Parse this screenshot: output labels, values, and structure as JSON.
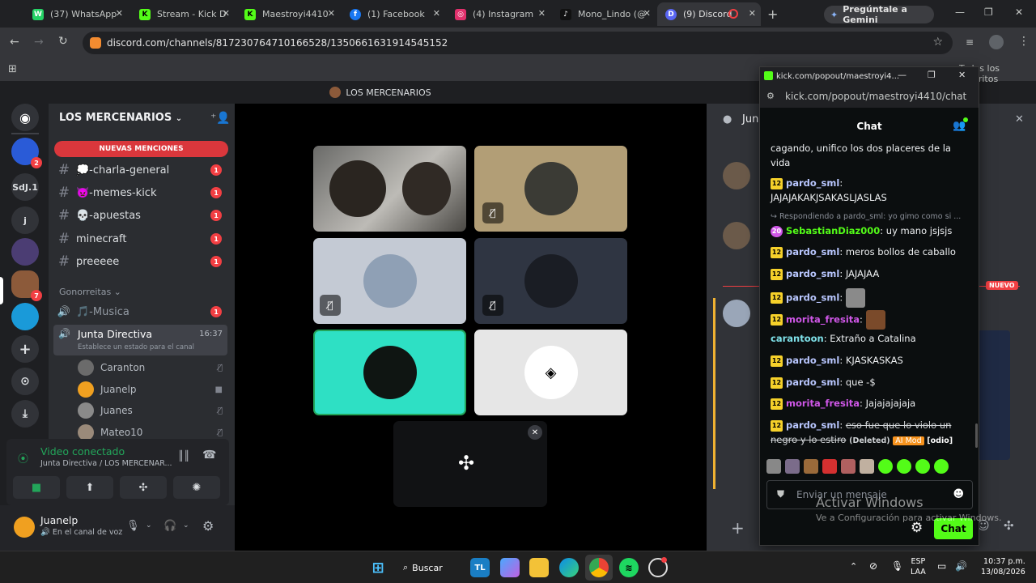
{
  "browser": {
    "tabs": [
      {
        "label": "(37) WhatsApp",
        "color": "#25d366",
        "glyph": "W"
      },
      {
        "label": "Stream - Kick D",
        "color": "#53fc18",
        "glyph": "K"
      },
      {
        "label": "Maestroyi4410",
        "color": "#53fc18",
        "glyph": "K"
      },
      {
        "label": "(1) Facebook",
        "color": "#1877f2",
        "glyph": "f"
      },
      {
        "label": "(4) Instagram",
        "color": "#e1306c",
        "glyph": "◎"
      },
      {
        "label": "Mono_Lindo (@",
        "color": "#111111",
        "glyph": "♪"
      },
      {
        "label": "(9) Discord",
        "color": "#5865f2",
        "glyph": "D"
      }
    ],
    "new_tab_icon": "+",
    "gemini_label": "Pregúntale a Gemini",
    "url": "discord.com/channels/817230764710166528/1350661631914545152",
    "bookmarks_label": "Todos los favoritos"
  },
  "discord": {
    "window_title": "LOS MERCENARIOS",
    "server_name": "LOS MERCENARIOS",
    "servers": [
      {
        "label": "",
        "badge": "2",
        "color": "#2a5bd7"
      },
      {
        "label": "SdJ.1",
        "badge": "",
        "color": "#313338"
      },
      {
        "label": "j",
        "badge": "",
        "color": "#313338"
      },
      {
        "label": "",
        "badge": "",
        "color": "#4b3d73"
      },
      {
        "label": "",
        "badge": "7",
        "color": "#8c5a3a"
      },
      {
        "label": "",
        "badge": "",
        "color": "#1a9ad9"
      }
    ],
    "new_mentions": "NUEVAS MENCIONES",
    "channels": [
      {
        "name": "💭-charla-general",
        "count": "1"
      },
      {
        "name": "👿-memes-kick",
        "count": "1"
      },
      {
        "name": "💀-apuestas",
        "count": "1"
      },
      {
        "name": "minecraft",
        "count": "1"
      },
      {
        "name": "preeeee",
        "count": "1"
      }
    ],
    "category": "Gonorreitas",
    "music_channel": "🎵-Musica",
    "music_count": "1",
    "voice_channel": "Junta Directiva",
    "voice_time": "16:37",
    "voice_status": "Establece un estado para el canal",
    "voice_users": [
      {
        "name": "Caranton",
        "color": "#6b6b6b",
        "icon": "mic-off"
      },
      {
        "name": "Juanelp",
        "color": "#f0a020",
        "icon": "camera"
      },
      {
        "name": "Juanes",
        "color": "#8a8a8a",
        "icon": "mic-off"
      },
      {
        "name": "Mateo10",
        "color": "#9a8a7a",
        "icon": "mic-off"
      }
    ],
    "video_connected": "Video conectado",
    "video_location": "Junta Directiva / LOS MERCENAR...",
    "user_name": "Juanelp",
    "user_status": "En el canal de voz",
    "right_header": "Jun",
    "new_badge": "NUEVO"
  },
  "kick_popup": {
    "title": "kick.com/popout/maestroyi4...",
    "url": "kick.com/popout/maestroyi4410/chat",
    "chat_title": "Chat",
    "messages": [
      {
        "level": "",
        "user": "",
        "color": "",
        "text": "cagando, unifico los dos placeres de la vida"
      },
      {
        "level": "12",
        "user": "pardo_sml",
        "color": "#b9c7ff",
        "text": "JAJAJAKAKJSAKASLJASLAS"
      },
      {
        "level": "20",
        "user": "SebastianDiaz000",
        "color": "#53fc18",
        "text": "uy mano jsjsjs"
      },
      {
        "level": "12",
        "user": "pardo_sml",
        "color": "#b9c7ff",
        "text": "meros bollos de caballo"
      },
      {
        "level": "12",
        "user": "pardo_sml",
        "color": "#b9c7ff",
        "text": "JAJAJAA"
      },
      {
        "level": "12",
        "user": "pardo_sml",
        "color": "#b9c7ff",
        "text": ""
      },
      {
        "level": "12",
        "user": "morita_fresita",
        "color": "#d057e8",
        "text": ""
      },
      {
        "level": "",
        "user": "carantoon",
        "color": "#7ee0e8",
        "text": "Extraño a Catalina"
      },
      {
        "level": "12",
        "user": "pardo_sml",
        "color": "#b9c7ff",
        "text": "KJASKASKAS"
      },
      {
        "level": "12",
        "user": "pardo_sml",
        "color": "#b9c7ff",
        "text": "que -$"
      },
      {
        "level": "12",
        "user": "morita_fresita",
        "color": "#d057e8",
        "text": "Jajajajajaja"
      },
      {
        "level": "12",
        "user": "pardo_sml",
        "color": "#b9c7ff",
        "text": "eso fue que lo violo un negro y lo estiro"
      }
    ],
    "reply_to": "Respondiendo a pardo_sml: yo gimo como si ...",
    "deleted_tag": "(Deleted)",
    "mod_tag": "AI Mod",
    "mod_reason": "[odio]",
    "input_placeholder": "Enviar un mensaje",
    "chat_button": "Chat"
  },
  "watermark": {
    "title": "Activar Windows",
    "subtitle": "Ve a Configuración para activar Windows."
  },
  "taskbar": {
    "search_label": "Buscar",
    "lang": "ESP",
    "lang2": "LAA",
    "time": "10:37 p.m.",
    "date": "13/08/2026"
  }
}
